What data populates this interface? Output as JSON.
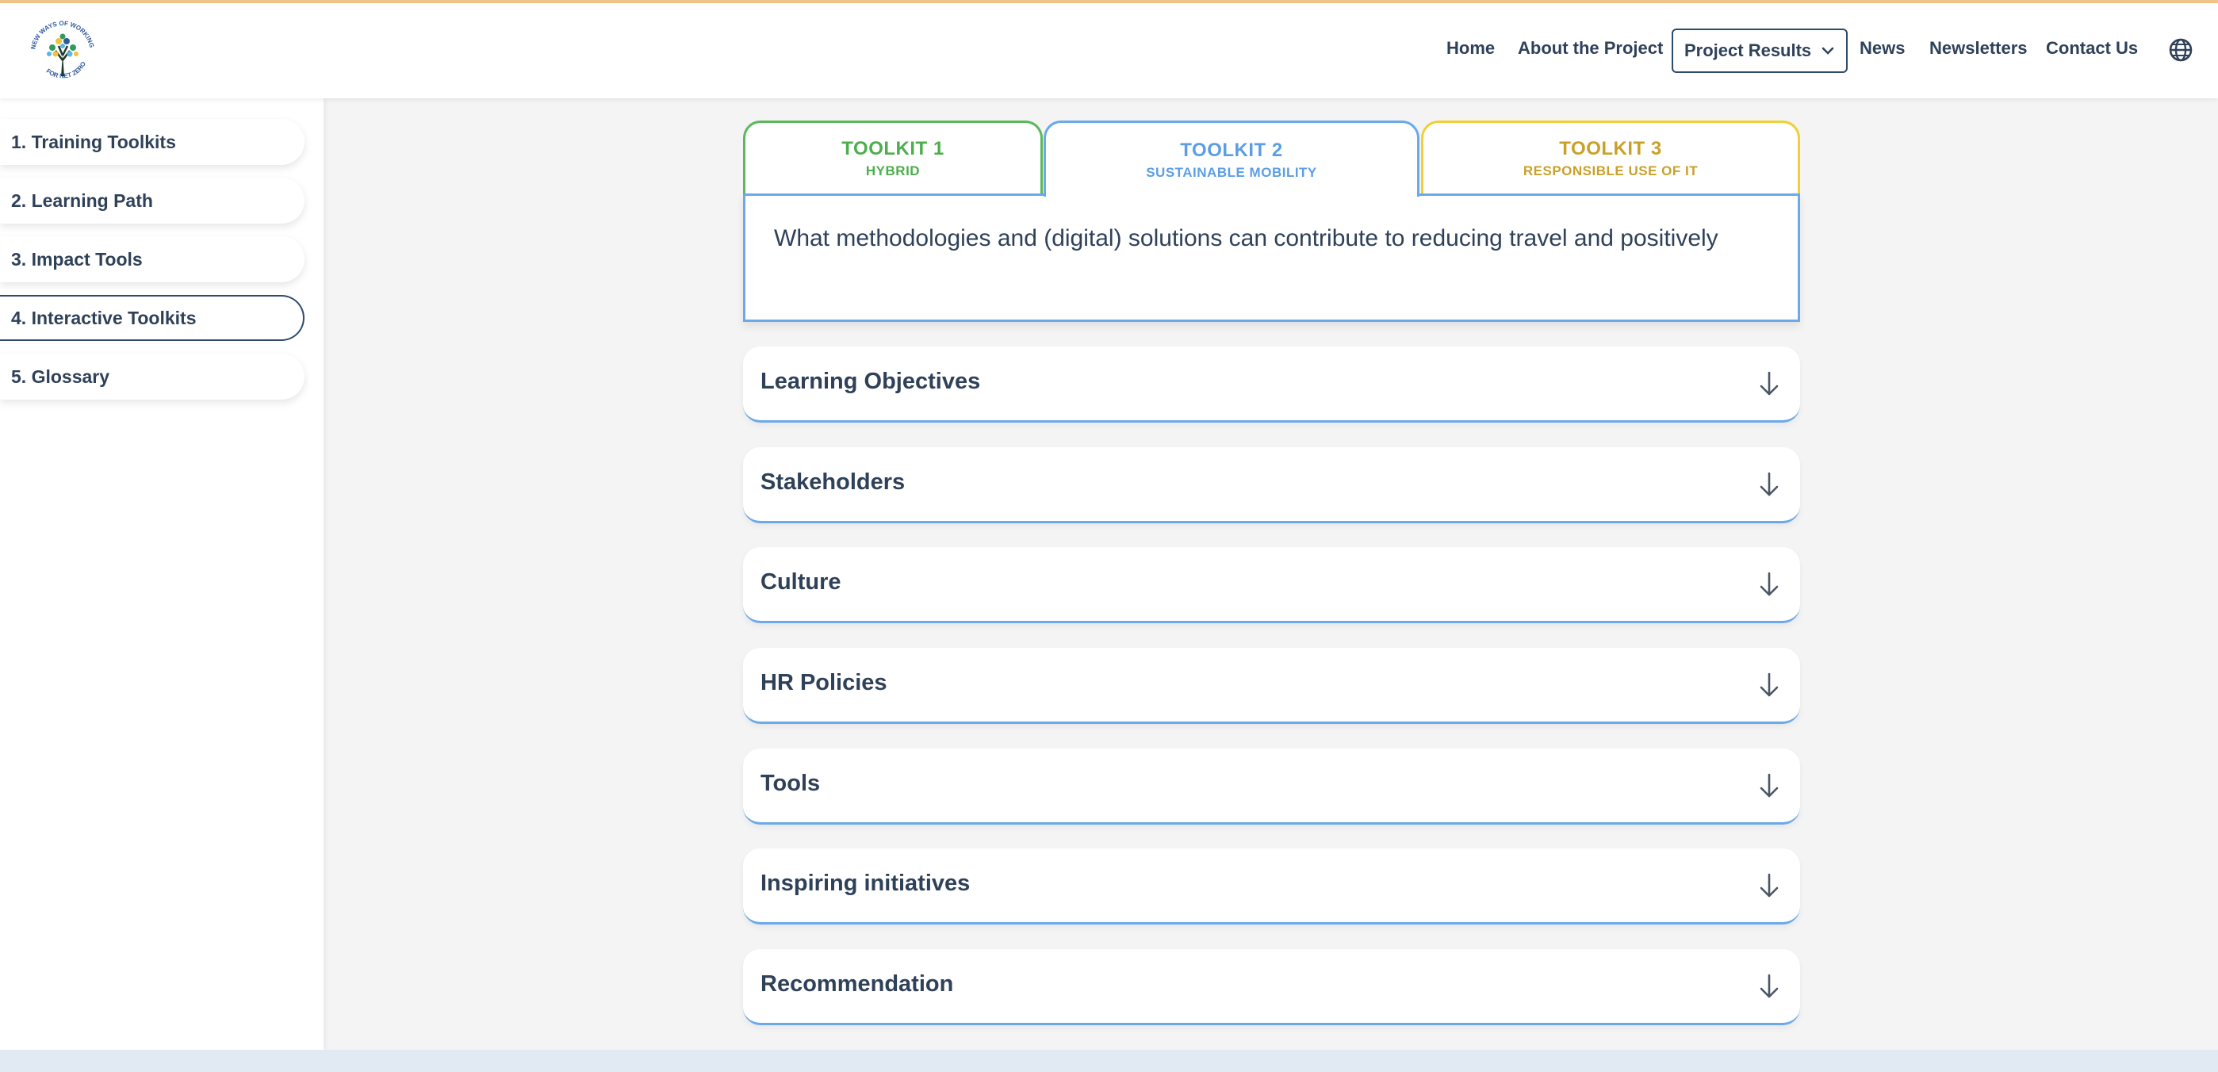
{
  "header": {
    "logo_text": "NEW WAYS OF WORKING FOR NET ZERO",
    "nav": [
      "Home",
      "About the Project",
      "Project Results",
      "News",
      "Newsletters",
      "Contact Us"
    ],
    "dropdown_label": "Project Results",
    "globe_icon": "globe-icon"
  },
  "sidebar": {
    "items": [
      {
        "label": "1. Training Toolkits",
        "active": false
      },
      {
        "label": "2. Learning Path",
        "active": false
      },
      {
        "label": "3. Impact Tools",
        "active": false
      },
      {
        "label": "4. Interactive Toolkits",
        "active": true
      },
      {
        "label": "5. Glossary",
        "active": false
      }
    ]
  },
  "tabs": [
    {
      "title": "TOOLKIT 1",
      "subtitle": "HYBRID",
      "color": "#4cae4c"
    },
    {
      "title": "TOOLKIT 2",
      "subtitle": "SUSTAINABLE MOBILITY",
      "color": "#5b9ee6",
      "active": true
    },
    {
      "title": "TOOLKIT 3",
      "subtitle": "RESPONSIBLE USE OF IT",
      "color": "#c9a12a"
    }
  ],
  "tab_panel": {
    "question": "What methodologies and (digital) solutions can contribute to reducing travel and positively"
  },
  "accordions": [
    {
      "title": "Learning Objectives"
    },
    {
      "title": "Stakeholders"
    },
    {
      "title": "Culture"
    },
    {
      "title": "HR Policies"
    },
    {
      "title": "Tools"
    },
    {
      "title": "Inspiring initiatives"
    },
    {
      "title": "Recommendation"
    }
  ],
  "colors": {
    "accent_blue": "#6aa9ea",
    "navy": "#2f4159",
    "green": "#4cae4c",
    "gold": "#c9a12a"
  }
}
